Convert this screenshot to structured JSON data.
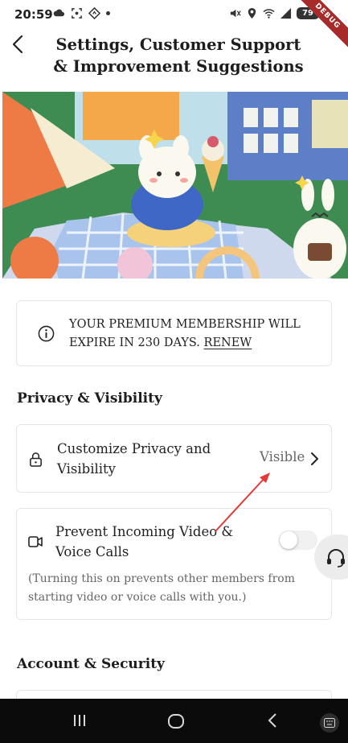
{
  "status_bar": {
    "time": "20:59",
    "battery": "79",
    "debug_label": "DEBUG"
  },
  "header": {
    "title": "Settings, Customer Support & Improvement Suggestions"
  },
  "notice": {
    "text": "YOUR PREMIUM MEMBERSHIP WILL EXPIRE IN 230 DAYS.",
    "link": "RENEW"
  },
  "privacy_section": {
    "title": "Privacy & Visibility",
    "customize_row": {
      "label": "Customize Privacy and Visibility",
      "value": "Visible"
    },
    "video_row": {
      "label": "Prevent Incoming Video & Voice Calls",
      "note": "(Turning this on prevents other members from starting video or voice calls with you.)",
      "toggle_on": false
    }
  },
  "account_section": {
    "title": "Account & Security"
  },
  "icons": {
    "back": "back-arrow-icon",
    "info": "info-icon",
    "lock": "lock-icon",
    "video": "video-camera-icon",
    "chevron": "chevron-right-icon",
    "support": "headset-icon"
  },
  "colors": {
    "annotation_arrow": "#e53935",
    "card_border": "#e6e6e6",
    "nav_bar": "#0b0b0b"
  }
}
